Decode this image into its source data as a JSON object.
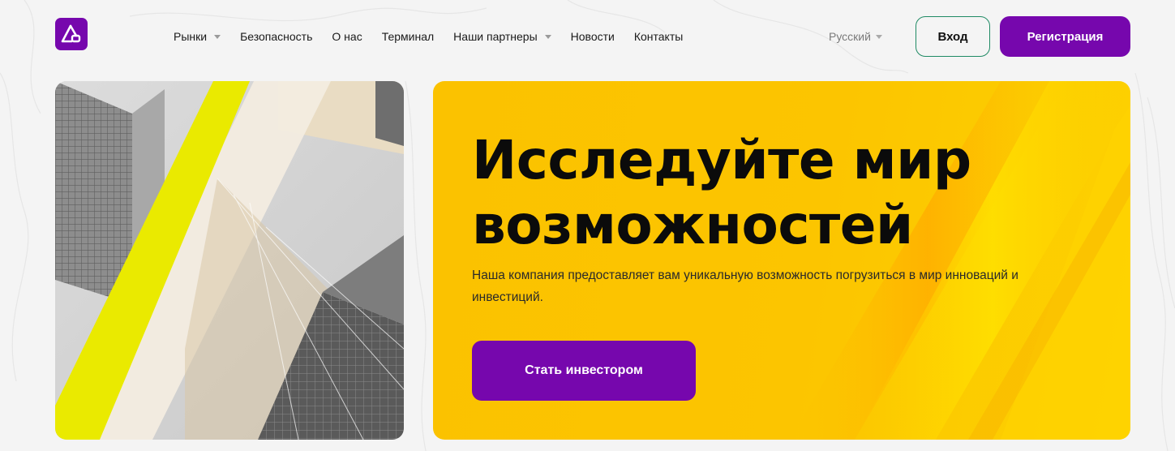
{
  "header": {
    "logo_icon": "triangle-logo-icon",
    "brand_color": "#7607ad",
    "nav": [
      {
        "label": "Рынки",
        "has_dropdown": true
      },
      {
        "label": "Безопасность",
        "has_dropdown": false
      },
      {
        "label": "О нас",
        "has_dropdown": false
      },
      {
        "label": "Терминал",
        "has_dropdown": false
      },
      {
        "label": "Наши партнеры",
        "has_dropdown": true
      },
      {
        "label": "Новости",
        "has_dropdown": false
      },
      {
        "label": "Контакты",
        "has_dropdown": false
      }
    ],
    "language": "Русский",
    "login_label": "Вход",
    "register_label": "Регистрация"
  },
  "hero": {
    "title_line1": "Исследуйте мир",
    "title_line2": "возможностей",
    "description": "Наша компания предоставляет вам уникальную возможность погрузиться в мир инноваций и инвестиций.",
    "cta_label": "Стать инвестором",
    "accent_color": "#fcc500"
  }
}
